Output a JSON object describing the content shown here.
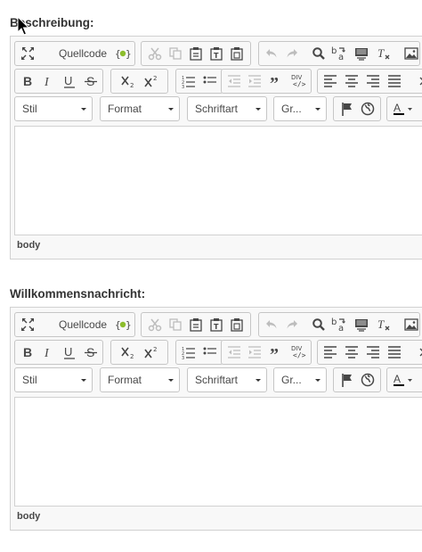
{
  "editors": [
    {
      "label": "Beschreibung:",
      "toolbar": {
        "source_label": "Quellcode",
        "combos": {
          "style": "Stil",
          "format": "Format",
          "font": "Schriftart",
          "size": "Gr..."
        }
      },
      "content": "",
      "path": "body"
    },
    {
      "label": "Willkommensnachricht:",
      "toolbar": {
        "source_label": "Quellcode",
        "combos": {
          "style": "Stil",
          "format": "Format",
          "font": "Schriftart",
          "size": "Gr..."
        }
      },
      "content": "",
      "path": "body"
    }
  ],
  "icons": {
    "row1": [
      "maximize-icon",
      "source-icon",
      "template-icon",
      "cut-icon",
      "copy-icon",
      "paste-icon",
      "paste-text-icon",
      "paste-word-icon",
      "undo-icon",
      "redo-icon",
      "find-icon",
      "replace-icon",
      "select-all-icon",
      "remove-format-icon",
      "image-icon"
    ],
    "row2": [
      "bold-icon",
      "italic-icon",
      "underline-icon",
      "strike-icon",
      "subscript-icon",
      "superscript-icon",
      "numbered-list-icon",
      "bulleted-list-icon",
      "outdent-icon",
      "indent-icon",
      "blockquote-icon",
      "div-icon",
      "align-left-icon",
      "align-center-icon",
      "align-right-icon",
      "justify-icon"
    ],
    "row3": [
      "anchor-flag-icon",
      "globe-icon",
      "text-color-icon"
    ]
  }
}
